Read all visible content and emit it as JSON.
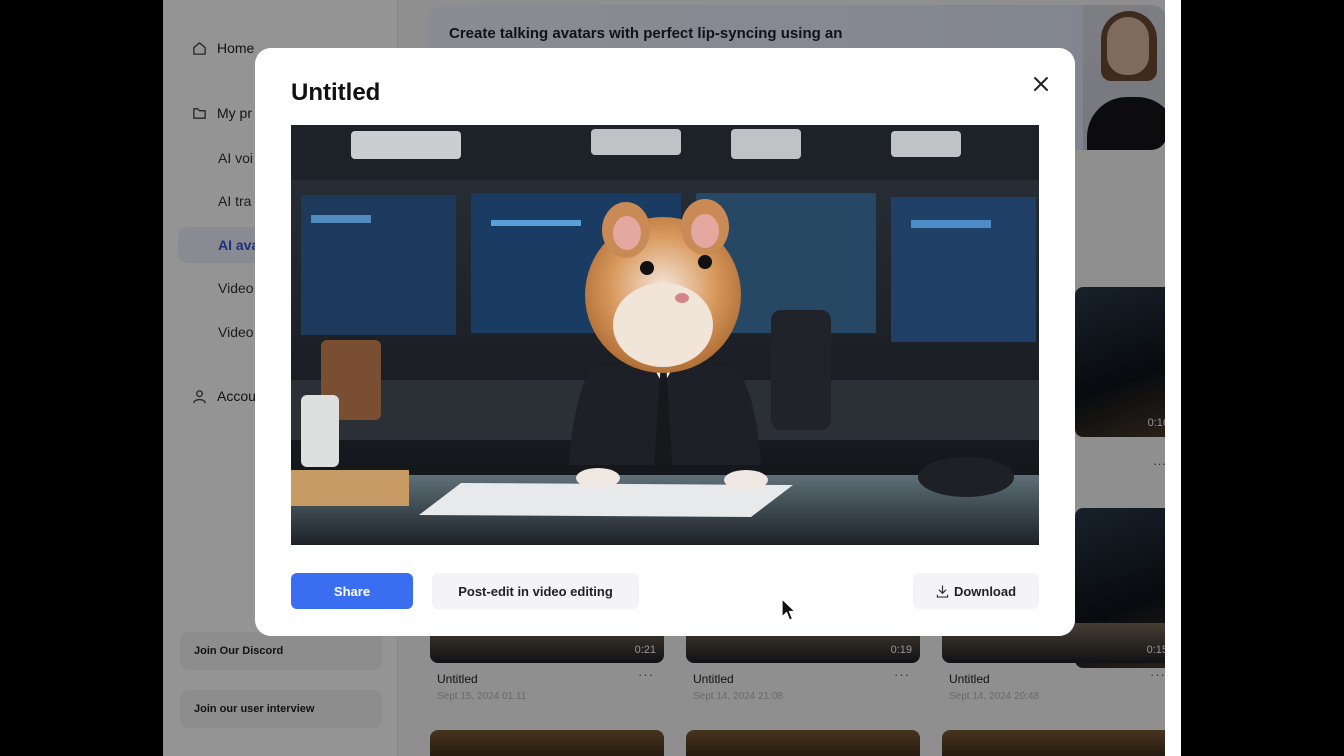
{
  "sidebar": {
    "home_label": "Home",
    "projects_label": "My pr",
    "sub_items": [
      "AI voi",
      "AI tra",
      "AI ava",
      "Video",
      "Video"
    ],
    "account_label": "Accou",
    "discord_label": "Join Our Discord",
    "interview_label": "Join our user interview"
  },
  "banner": {
    "text": "Create talking avatars with perfect lip-syncing using an"
  },
  "grid": {
    "cards": [
      {
        "title": "Untitled",
        "date": "Sept 15, 2024 01:11",
        "duration": "0:21"
      },
      {
        "title": "Untitled",
        "date": "Sept 14, 2024 21:08",
        "duration": "0:19"
      },
      {
        "title": "Untitled",
        "date": "Sept 14, 2024 20:48",
        "duration": "0:15"
      }
    ],
    "side_duration": "0:16",
    "more": "···"
  },
  "modal": {
    "title": "Untitled",
    "share_label": "Share",
    "post_edit_label": "Post-edit in video editing",
    "download_label": "Download"
  },
  "colors": {
    "accent": "#3a6df0",
    "active_nav": "#2f55d4"
  }
}
